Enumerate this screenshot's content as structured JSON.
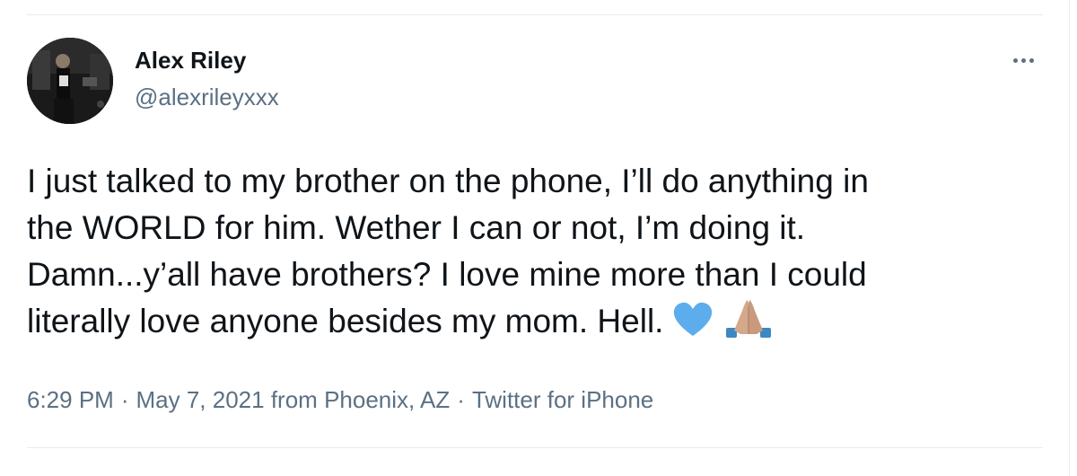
{
  "author": {
    "display_name": "Alex Riley",
    "handle": "@alexrileyxxx",
    "avatar_icon": "profile-photo-avatar"
  },
  "menu": {
    "more_icon": "more-options-icon"
  },
  "tweet": {
    "lines": [
      "I just talked to my brother on the phone, I’ll do anything in",
      "the WORLD for him. Wether I can or not, I’m doing it.",
      "Damn...y’all have brothers? I love mine more than I could",
      "literally love anyone besides my mom. Hell."
    ],
    "emojis": [
      "blue-heart-emoji",
      "folded-hands-emoji"
    ],
    "colors": {
      "heart": "#5dadec",
      "hands_skin": "#d4a88a",
      "sleeve": "#3b88c3"
    }
  },
  "meta": {
    "time": "6:29 PM",
    "date": "May 7, 2021",
    "location_prefix": "from",
    "location": "Phoenix, AZ",
    "separator": "·",
    "source": "Twitter for iPhone"
  },
  "colors": {
    "text": "#0f1419",
    "secondary": "#5b7083",
    "divider": "#e6ecf0"
  }
}
